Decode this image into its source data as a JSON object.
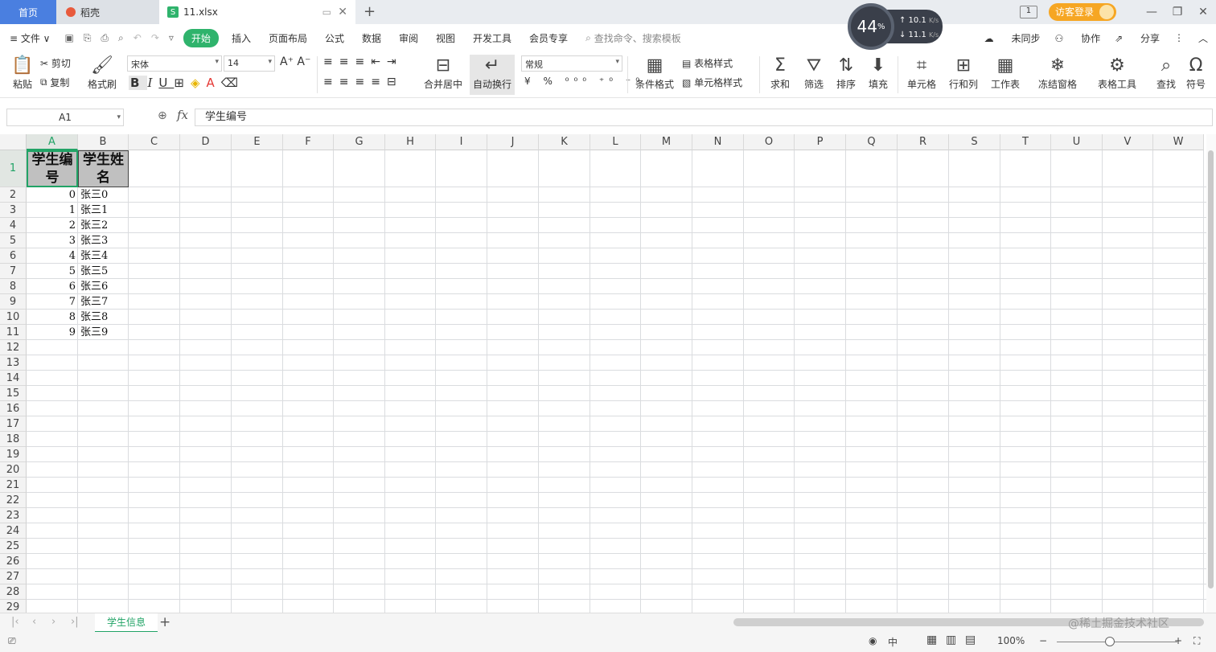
{
  "titlebar": {
    "home_tab": "首页",
    "daoke_tab": "稻壳",
    "file_tab": "11.xlsx",
    "file_icon": "S",
    "speed": {
      "percent": "44",
      "percent_unit": "%",
      "up": "↑ 10.1",
      "down": "↓ 11.1",
      "unit": "K/s"
    },
    "window_count": "1",
    "login": "访客登录"
  },
  "menubar": {
    "file": "≡ 文件 ∨",
    "items": [
      "开始",
      "插入",
      "页面布局",
      "公式",
      "数据",
      "审阅",
      "视图",
      "开发工具",
      "会员专享"
    ],
    "search": "查找命令、搜索模板",
    "sync": "未同步",
    "collab": "协作",
    "share": "分享"
  },
  "ribbon": {
    "paste": "粘贴",
    "cut": "剪切",
    "copy": "复制",
    "format_painter": "格式刷",
    "font_name": "宋体",
    "font_size": "14",
    "merge_center": "合并居中",
    "wrap_text": "自动换行",
    "number_format": "常规",
    "cond_format": "条件格式",
    "table_style": "表格样式",
    "cell_style": "单元格样式",
    "sum": "求和",
    "filter": "筛选",
    "sort": "排序",
    "fill": "填充",
    "cells": "单元格",
    "rows_cols": "行和列",
    "sheet": "工作表",
    "freeze": "冻结窗格",
    "table_tools": "表格工具",
    "find": "查找",
    "symbol": "符号"
  },
  "formula_bar": {
    "cell_ref": "A1",
    "fx": "fx",
    "content": "学生编号"
  },
  "columns": [
    "A",
    "B",
    "C",
    "D",
    "E",
    "F",
    "G",
    "H",
    "I",
    "J",
    "K",
    "L",
    "M",
    "N",
    "O",
    "P",
    "Q",
    "R",
    "S",
    "T",
    "U",
    "V",
    "W"
  ],
  "rows": [
    "1",
    "2",
    "3",
    "4",
    "5",
    "6",
    "7",
    "8",
    "9",
    "10",
    "11",
    "12",
    "13",
    "14",
    "15",
    "16",
    "17",
    "18",
    "19",
    "20",
    "21",
    "22",
    "23",
    "24",
    "25",
    "26",
    "27",
    "28",
    "29"
  ],
  "sheet": {
    "header": [
      "学生编号",
      "学生姓名"
    ],
    "data": [
      [
        "0",
        "张三0"
      ],
      [
        "1",
        "张三1"
      ],
      [
        "2",
        "张三2"
      ],
      [
        "3",
        "张三3"
      ],
      [
        "4",
        "张三4"
      ],
      [
        "5",
        "张三5"
      ],
      [
        "6",
        "张三6"
      ],
      [
        "7",
        "张三7"
      ],
      [
        "8",
        "张三8"
      ],
      [
        "9",
        "张三9"
      ]
    ]
  },
  "sheet_tabs": {
    "active": "学生信息",
    "add": "+"
  },
  "watermark": "@稀土掘金技术社区",
  "status": {
    "zoom": "100%",
    "input_mode": "中"
  },
  "colors": {
    "accent": "#21a366",
    "home_tab": "#4a7fe0",
    "login": "#f6a623",
    "header_fill": "#c0c0c0"
  }
}
